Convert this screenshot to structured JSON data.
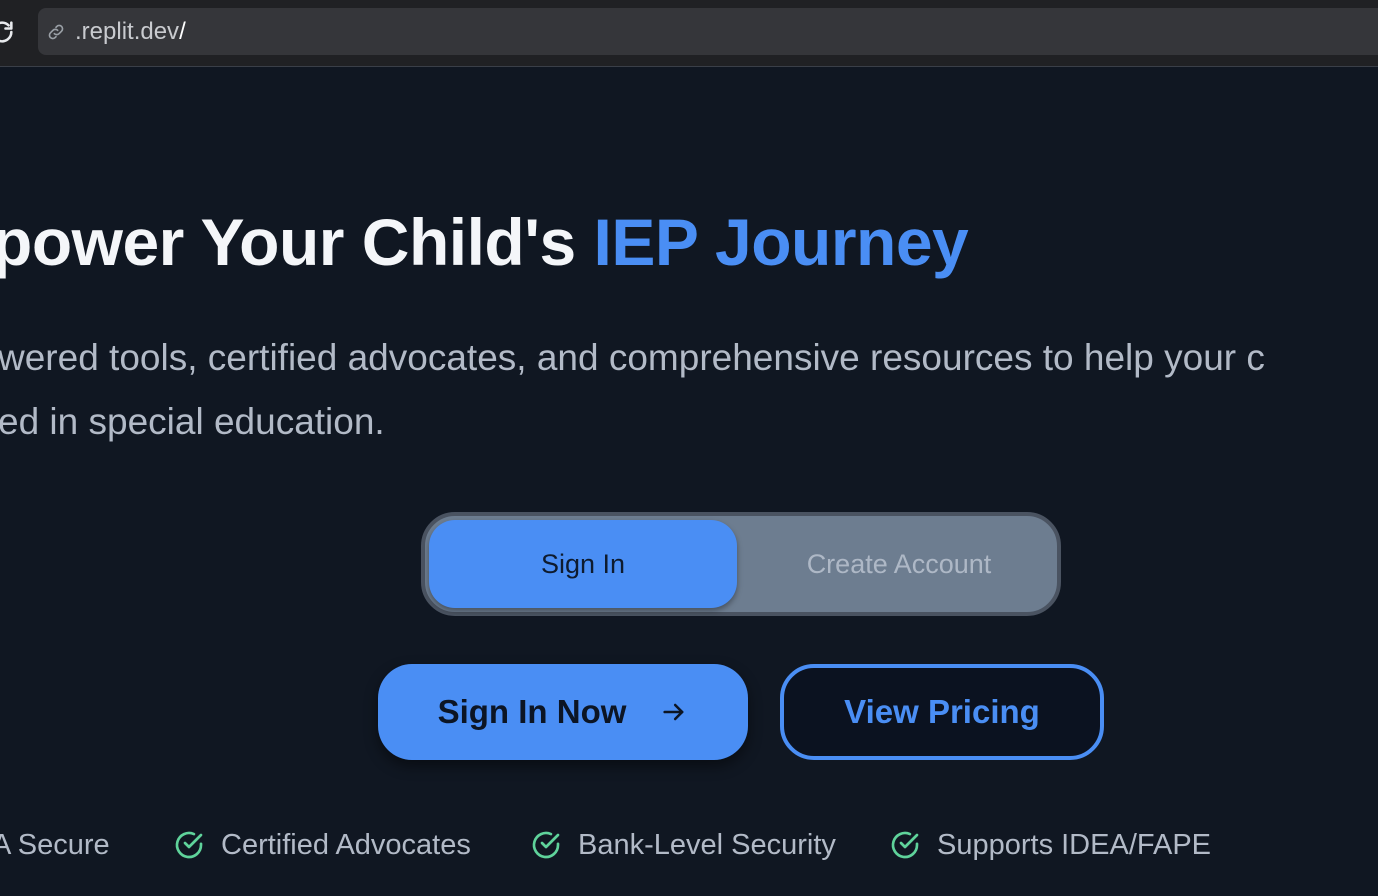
{
  "browser": {
    "url_host": ".replit.dev",
    "url_path": "/"
  },
  "hero": {
    "title_main": "power Your Child's ",
    "title_accent": "IEP Journey",
    "subtitle_line1": "wered tools, certified advocates, and comprehensive resources to help your c",
    "subtitle_line2": "ed in special education."
  },
  "auth_toggle": {
    "sign_in": "Sign In",
    "create_account": "Create Account",
    "selected": "Sign In"
  },
  "actions": {
    "primary": "Sign In Now",
    "secondary": "View Pricing"
  },
  "trust_badges": [
    "A Secure",
    "Certified Advocates",
    "Bank-Level Security",
    "Supports IDEA/FAPE"
  ],
  "colors": {
    "background": "#101722",
    "accent": "#4a8ef4",
    "check": "#5fd39b",
    "muted_text": "#b2bac7"
  }
}
